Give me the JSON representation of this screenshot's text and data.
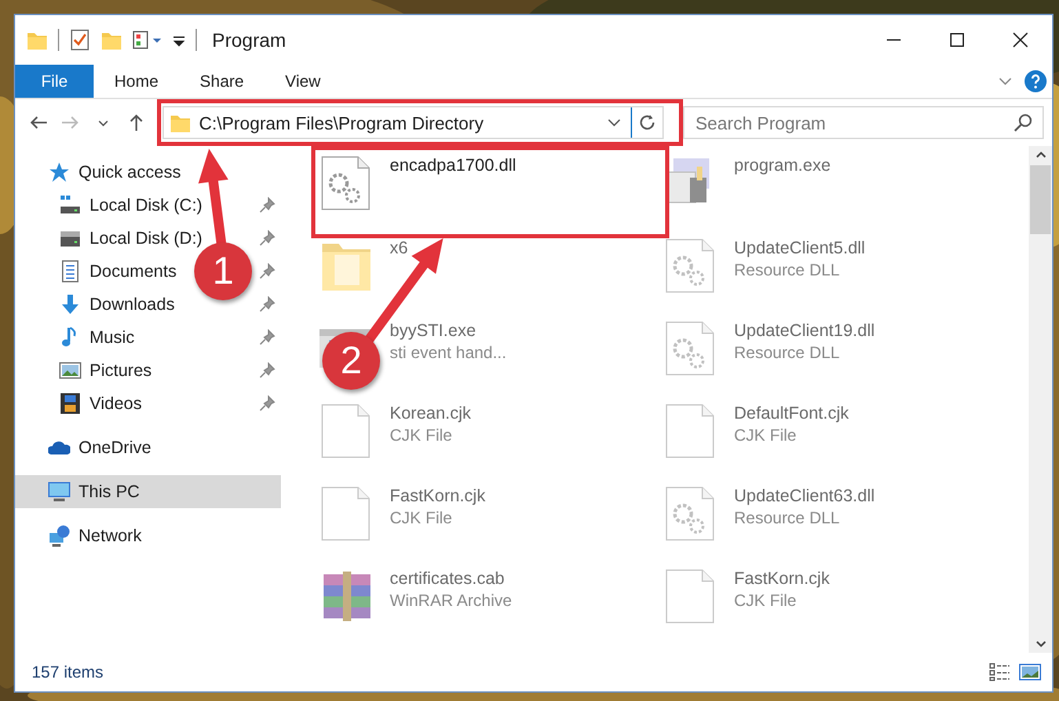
{
  "window": {
    "title": "Program"
  },
  "ribbon_tabs": [
    {
      "label": "File",
      "kind": "file"
    },
    {
      "label": "Home",
      "kind": "tab"
    },
    {
      "label": "Share",
      "kind": "tab"
    },
    {
      "label": "View",
      "kind": "tab"
    }
  ],
  "address": {
    "path": "C:\\Program Files\\Program Directory"
  },
  "search": {
    "placeholder": "Search Program"
  },
  "sidebar": {
    "items": [
      {
        "label": "Quick access",
        "kind": "star",
        "selected": false,
        "children": [
          {
            "label": "Local Disk (C:)",
            "kind": "disk-c",
            "pinned": true,
            "selected": false
          },
          {
            "label": "Local Disk (D:)",
            "kind": "disk",
            "pinned": true,
            "selected": false
          },
          {
            "label": "Documents",
            "kind": "docs",
            "pinned": true,
            "selected": false
          },
          {
            "label": "Downloads",
            "kind": "down",
            "pinned": true,
            "selected": false
          },
          {
            "label": "Music",
            "kind": "music",
            "pinned": true,
            "selected": false
          },
          {
            "label": "Pictures",
            "kind": "pics",
            "pinned": true,
            "selected": false
          },
          {
            "label": "Videos",
            "kind": "video",
            "pinned": true,
            "selected": false
          }
        ]
      },
      {
        "label": "OneDrive",
        "kind": "cloud",
        "selected": false
      },
      {
        "label": "This PC",
        "kind": "pc",
        "selected": true
      },
      {
        "label": "Network",
        "kind": "net",
        "selected": false
      }
    ]
  },
  "files": [
    {
      "name": "encadpa1700.dll",
      "kind": "dll",
      "blurred": false
    },
    {
      "name": "program.exe",
      "kind": "app",
      "blurred": true
    },
    {
      "name": "x6",
      "kind": "folder",
      "blurred": true
    },
    {
      "name": "UpdateClient5.dll",
      "type": "Resource DLL",
      "kind": "dll",
      "blurred": true
    },
    {
      "name": "byySTI.exe",
      "type": "sti event hand...",
      "kind": "exe",
      "blurred": true
    },
    {
      "name": "UpdateClient19.dll",
      "type": "Resource DLL",
      "kind": "dll",
      "blurred": true
    },
    {
      "name": "Korean.cjk",
      "type": "CJK File",
      "kind": "blank",
      "blurred": true
    },
    {
      "name": "DefaultFont.cjk",
      "type": "CJK File",
      "kind": "blank",
      "blurred": true
    },
    {
      "name": "FastKorn.cjk",
      "type": "CJK File",
      "kind": "blank",
      "blurred": true
    },
    {
      "name": "UpdateClient63.dll",
      "type": "Resource DLL",
      "kind": "dll",
      "blurred": true
    },
    {
      "name": "certificates.cab",
      "type": "WinRAR Archive",
      "kind": "cab",
      "blurred": true
    },
    {
      "name": "FastKorn.cjk",
      "type": "CJK File",
      "kind": "blank",
      "blurred": true
    }
  ],
  "status_bar": {
    "count": "157 items"
  },
  "annotations": [
    {
      "number": "1"
    },
    {
      "number": "2"
    }
  ]
}
